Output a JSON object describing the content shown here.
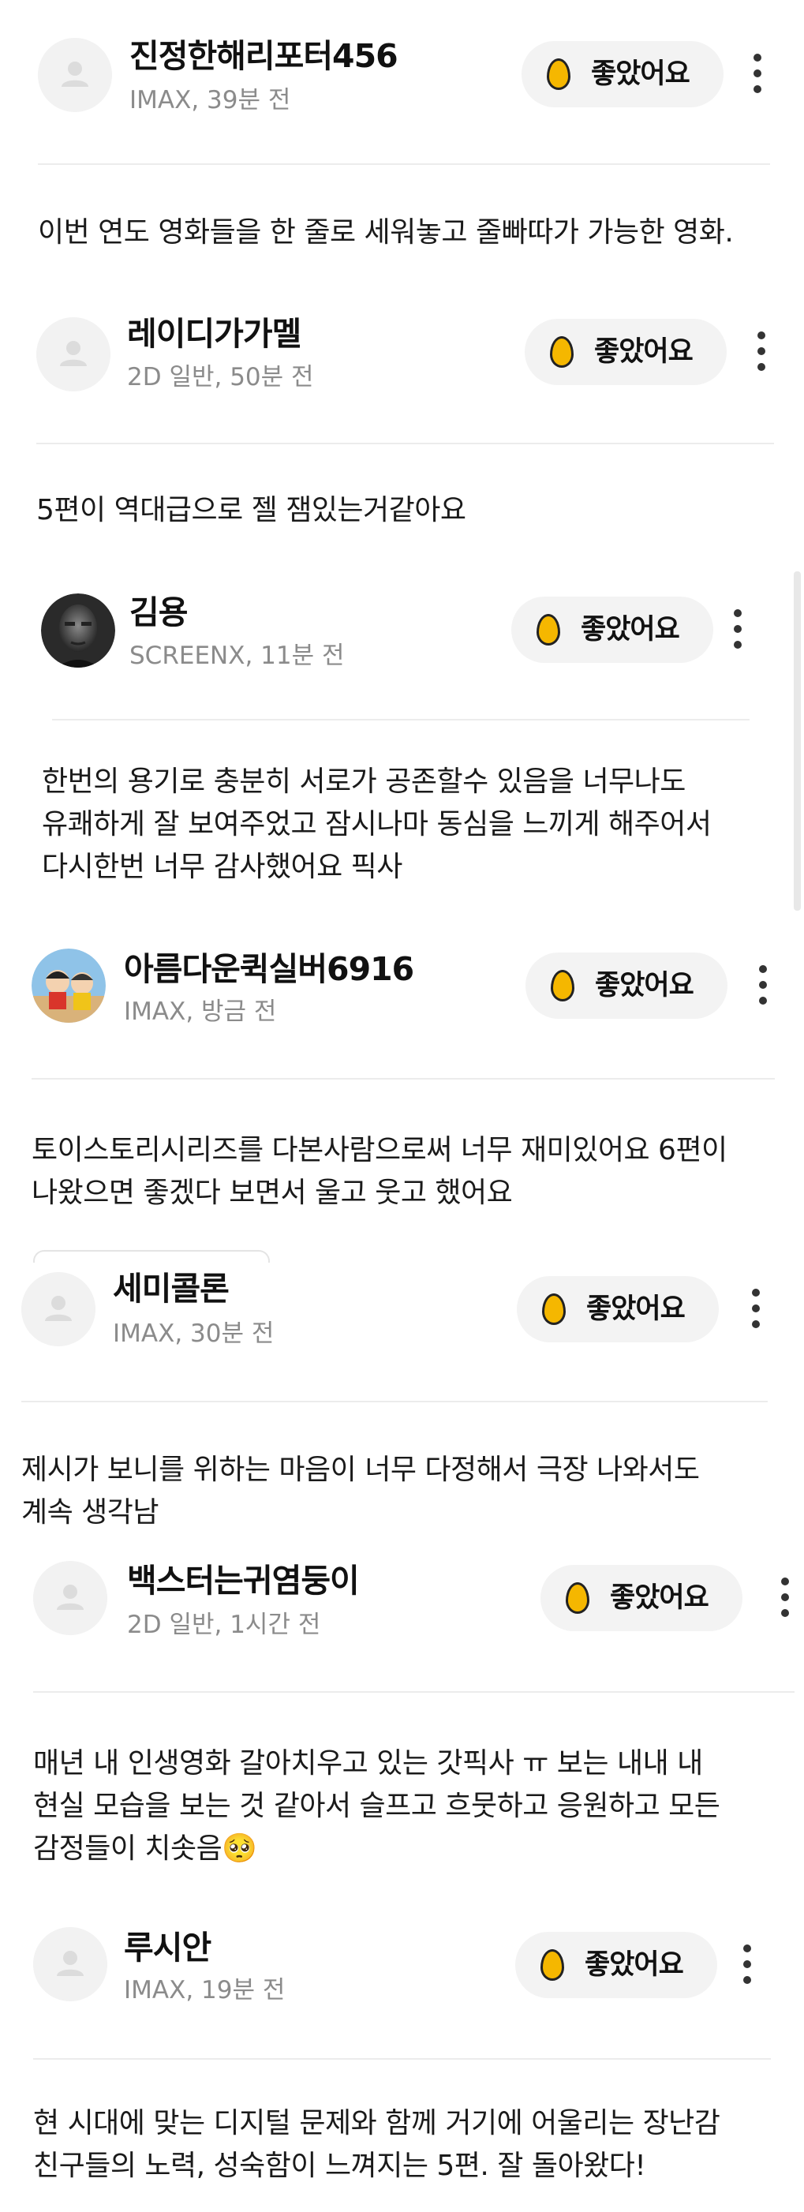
{
  "like_label": "좋았어요",
  "colors": {
    "egg": "#f5b700",
    "button_bg": "#f3f3f3",
    "meta_text": "#8b8b8b",
    "divider": "#ececec"
  },
  "icons": {
    "like": "egg-icon",
    "more": "more-vertical-icon",
    "default_avatar": "user-icon"
  },
  "reviews": [
    {
      "nickname": "진정한해리포터456",
      "meta": "IMAX, 39분 전",
      "avatar": "default",
      "lines": [
        "이번 연도 영화들을 한 줄로 세워놓고 줄빠따가 가능한 영화."
      ]
    },
    {
      "nickname": "레이디가가멜",
      "meta": "2D 일반, 50분 전",
      "avatar": "default",
      "lines": [
        "5편이 역대급으로 젤 잼있는거같아요"
      ]
    },
    {
      "nickname": "김용",
      "meta": "SCREENX, 11분 전",
      "avatar": "photo",
      "lines": [
        "한번의 용기로 충분히 서로가 공존할수 있음을 너무나도",
        "유쾌하게 잘 보여주었고 잠시나마 동심을 느끼게 해주어서",
        "다시한번 너무 감사했어요 픽사"
      ]
    },
    {
      "nickname": "아름다운퀵실버6916",
      "meta": "IMAX, 방금 전",
      "avatar": "illustration",
      "lines": [
        "토이스토리시리즈를 다본사람으로써 너무 재미있어요 6편이",
        "나왔으면 좋겠다 보면서 울고 웃고 했어요"
      ]
    },
    {
      "nickname": "세미콜론",
      "meta": "IMAX, 30분 전",
      "avatar": "default",
      "lines": [
        "제시가 보니를 위하는 마음이 너무 다정해서 극장 나와서도",
        "계속 생각남"
      ]
    },
    {
      "nickname": "백스터는귀염둥이",
      "meta": "2D 일반, 1시간 전",
      "avatar": "default",
      "lines": [
        "매년 내 인생영화 갈아치우고 있는 갓픽사 ㅠ 보는 내내 내",
        "현실 모습을 보는 것 같아서 슬프고 흐뭇하고 응원하고 모든",
        "감정들이 치솟음🥺"
      ]
    },
    {
      "nickname": "루시안",
      "meta": "IMAX, 19분 전",
      "avatar": "default",
      "lines": [
        "현 시대에 맞는 디지털 문제와 함께 거기에 어울리는 장난감",
        "친구들의 노력, 성숙함이 느껴지는 5편. 잘 돌아왔다!"
      ]
    }
  ]
}
